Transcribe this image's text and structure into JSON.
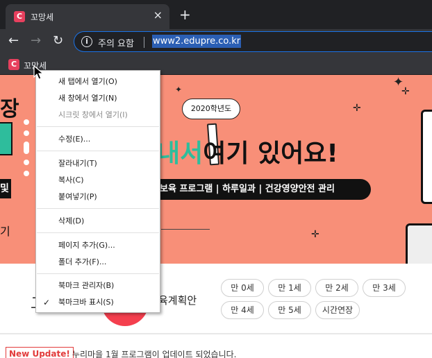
{
  "browser": {
    "tab_title": "꼬망세",
    "tab_favicon": "C",
    "tab_close": "×",
    "new_tab": "+",
    "security_text": "주의 요함",
    "url": "www2.edupre.co.kr",
    "back_icon": "←",
    "forward_icon": "→",
    "reload_icon": "↻",
    "info_icon": "i"
  },
  "bookmarks_bar": {
    "items": [
      {
        "label": "꼬망세",
        "favicon": "C"
      }
    ]
  },
  "context_menu": {
    "items": [
      {
        "label": "새 탭에서 열기(O)",
        "disabled": false
      },
      {
        "label": "새 창에서 열기(N)",
        "disabled": false
      },
      {
        "label": "시크릿 창에서 열기(I)",
        "disabled": true
      },
      {
        "label": "수정(E)...",
        "disabled": false
      },
      {
        "label": "잘라내기(T)",
        "disabled": false
      },
      {
        "label": "복사(C)",
        "disabled": false
      },
      {
        "label": "붙여넣기(P)",
        "disabled": false
      },
      {
        "label": "삭제(D)",
        "disabled": false
      },
      {
        "label": "페이지 추가(G)...",
        "disabled": false
      },
      {
        "label": "폴더 추가(F)...",
        "disabled": false
      },
      {
        "label": "북마크 관리자(B)",
        "disabled": false
      },
      {
        "label": "북마크바 표시(S)",
        "disabled": false,
        "checked": true
      }
    ],
    "check_mark": "✓"
  },
  "banner": {
    "year_badge": "2020학년도",
    "headline_green": "내서",
    "headline_black": "여기 있어요!",
    "subtitle": "보육 프로그램 | 하루일과 | 건강영양안전 관리",
    "left_text_1": "장",
    "left_text_3": "및",
    "left_text_4": "기"
  },
  "content": {
    "plan_title": "육계획안",
    "left_glyph": "고",
    "age_chips": [
      "만 0세",
      "만 1세",
      "만 2세",
      "만 3세",
      "만 4세",
      "만 5세",
      "시간연장"
    ],
    "update_badge": "New Update!",
    "update_text": "누리마을 1월 프로그램이 업데이트 되었습니다."
  }
}
